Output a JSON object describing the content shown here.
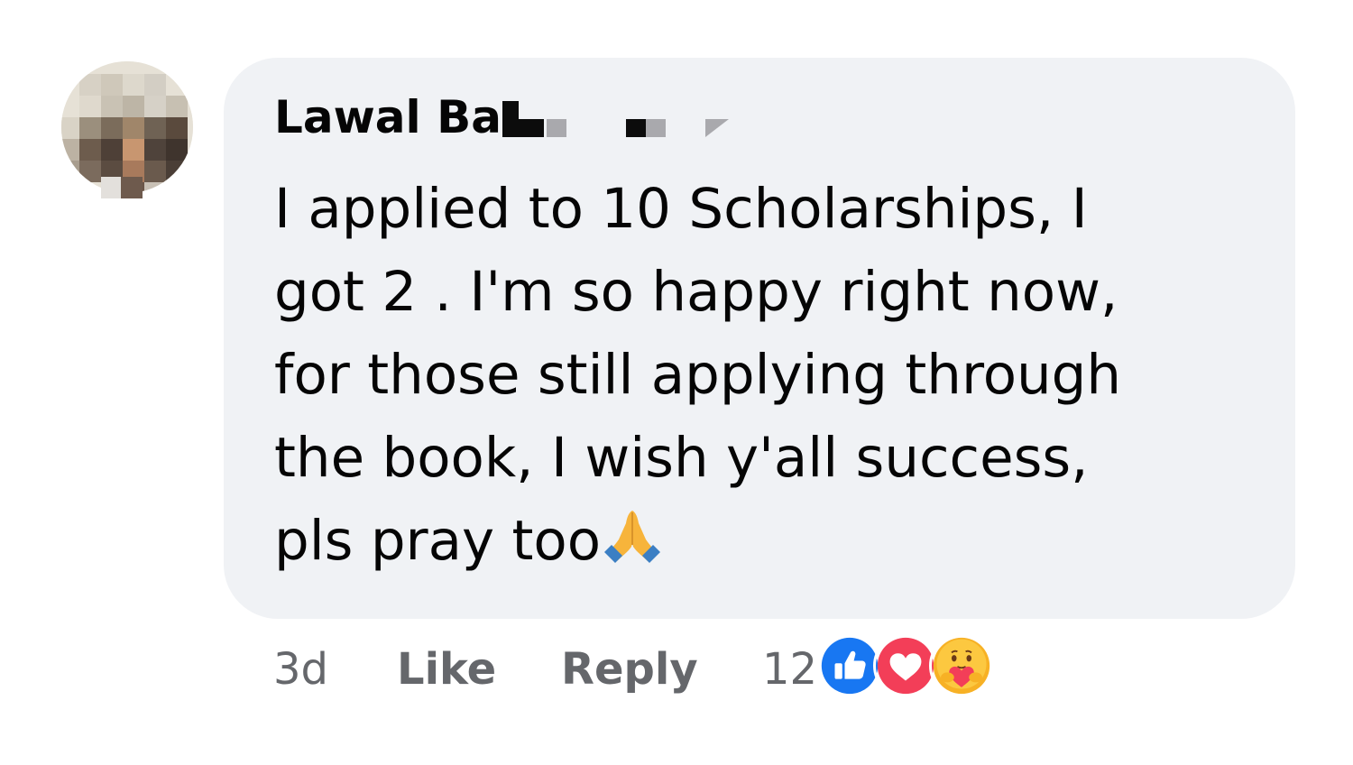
{
  "comment": {
    "author": "Lawal Ba",
    "text_lines": [
      "I applied to 10 Scholarships, I",
      "got 2 . I'm so happy right now,",
      "for those still applying through",
      "the book, I wish y'all success,",
      "pls pray too"
    ],
    "emoji": "folded-hands-icon"
  },
  "actions": {
    "time": "3d",
    "like_label": "Like",
    "reply_label": "Reply",
    "reaction_count": "12",
    "reactions": [
      "like-icon",
      "love-icon",
      "care-icon"
    ]
  },
  "colors": {
    "bubble": "#f0f2f5",
    "secondary_text": "#65676b",
    "like_blue": "#1877f2",
    "love_red": "#f33e58",
    "care_yellow": "#f7b125"
  }
}
